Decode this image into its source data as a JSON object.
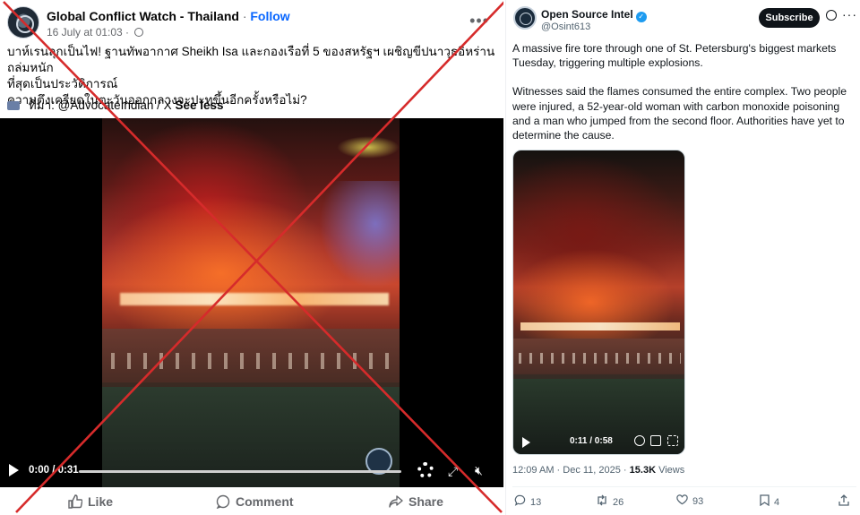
{
  "facebook_post": {
    "page_name": "Global Conflict Watch - Thailand",
    "separator": "·",
    "follow_label": "Follow",
    "date": "16 July at 01:03 ·",
    "text_lines": [
      "บาห์เรนลุกเป็นไฟ! ฐานทัพอากาศ Sheikh Isa และกองเรือที่ 5 ของสหรัฐฯ เผชิญขีปนาวุธอิหร่านถล่มหนัก",
      "ที่สุดเป็นประวัติการณ์",
      "ความตึงเครียดในตะวันออกกลางจะปะทุขึ้นอีกครั้งหรือไม่?"
    ],
    "source_prefix": "ที่มา: @AdvocateIndian / X",
    "see_less_label": "See less",
    "video_time": "0:00 / 0:31",
    "actions": {
      "like": "Like",
      "comment": "Comment",
      "share": "Share"
    },
    "icons": [
      "more-options-icon",
      "globe-icon",
      "camera-icon",
      "play-icon",
      "settings-gear-icon",
      "expand-icon",
      "mute-icon",
      "like-thumb-icon",
      "comment-bubble-icon",
      "share-arrow-icon"
    ]
  },
  "x_post": {
    "display_name": "Open Source Intel",
    "verified": true,
    "handle": "@Osint613",
    "subscribe_label": "Subscribe",
    "paragraphs": [
      "A massive fire tore through one of St. Petersburg's biggest markets Tuesday, triggering multiple explosions.",
      "Witnesses said the flames consumed the entire complex. Two people were injured, a 52-year-old woman with carbon monoxide poisoning and a man who jumped from the second floor. Authorities have yet to determine the cause."
    ],
    "video_time": "0:11 / 0:58",
    "timestamp": "12:09 AM · Dec 11, 2025 ·",
    "views_count": "15.3K",
    "views_label": "Views",
    "stats": {
      "replies": "13",
      "reposts": "26",
      "likes": "93",
      "bookmarks": "4"
    }
  },
  "overlay": {
    "mark_color": "#d62b2b",
    "meaning": "crossed-out"
  },
  "colors": {
    "fb_blue": "#0866ff",
    "x_black": "#0f1419",
    "x_blue": "#1d9bf0",
    "muted": "#65676b"
  }
}
